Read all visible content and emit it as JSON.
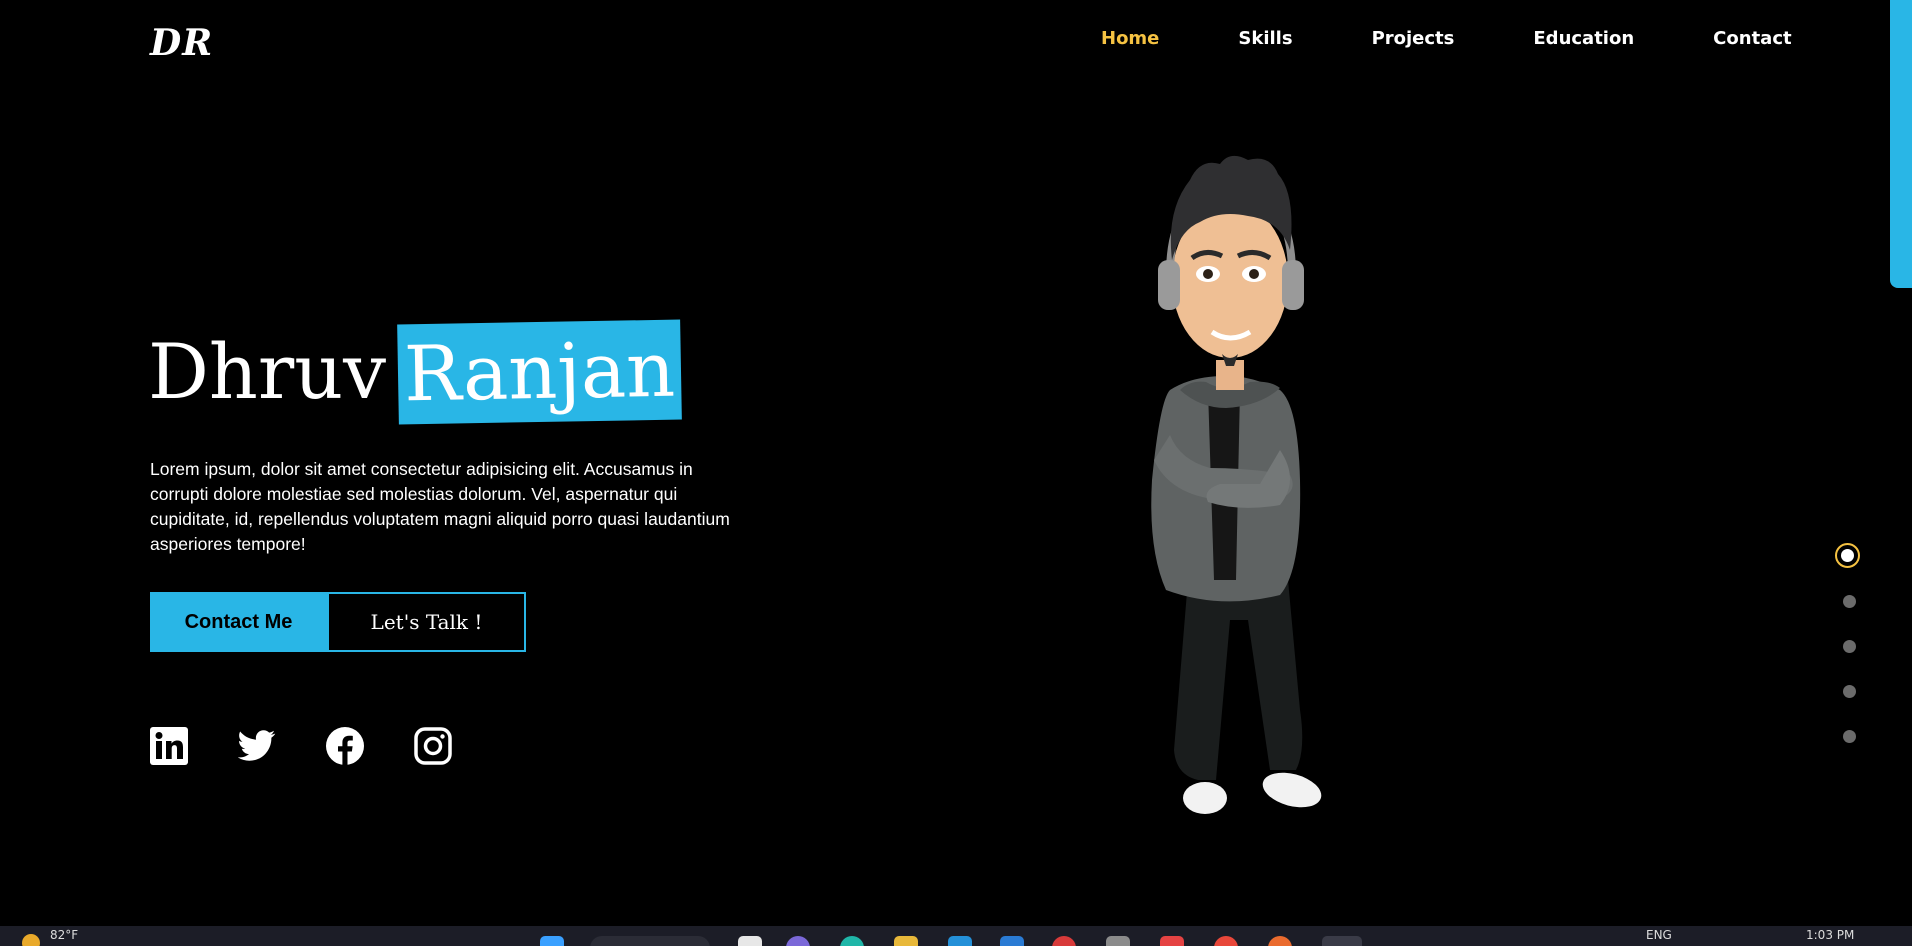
{
  "header": {
    "logo": "DR",
    "nav": [
      {
        "label": "Home",
        "active": true
      },
      {
        "label": "Skills",
        "active": false
      },
      {
        "label": "Projects",
        "active": false
      },
      {
        "label": "Education",
        "active": false
      },
      {
        "label": "Contact",
        "active": false
      }
    ]
  },
  "hero": {
    "first_name": "Dhruv",
    "last_name": "Ranjan",
    "description": "Lorem ipsum, dolor sit amet consectetur adipisicing elit. Accusamus in corrupti dolore molestiae sed molestias dolorum. Vel, aspernatur qui cupiditate, id, repellendus voluptatem magni aliquid porro quasi laudantium asperiores tempore!",
    "contact_button": "Contact Me",
    "talk_button": "Let's Talk !",
    "socials": [
      "linkedin-icon",
      "twitter-icon",
      "facebook-icon",
      "instagram-icon"
    ]
  },
  "pagination": {
    "count": 5,
    "active_index": 0
  },
  "taskbar": {
    "temperature": "82°F",
    "language": "ENG",
    "time": "1:03 PM"
  },
  "colors": {
    "accent": "#29b6e6",
    "active_nav": "#f5c242",
    "background": "#000000"
  }
}
